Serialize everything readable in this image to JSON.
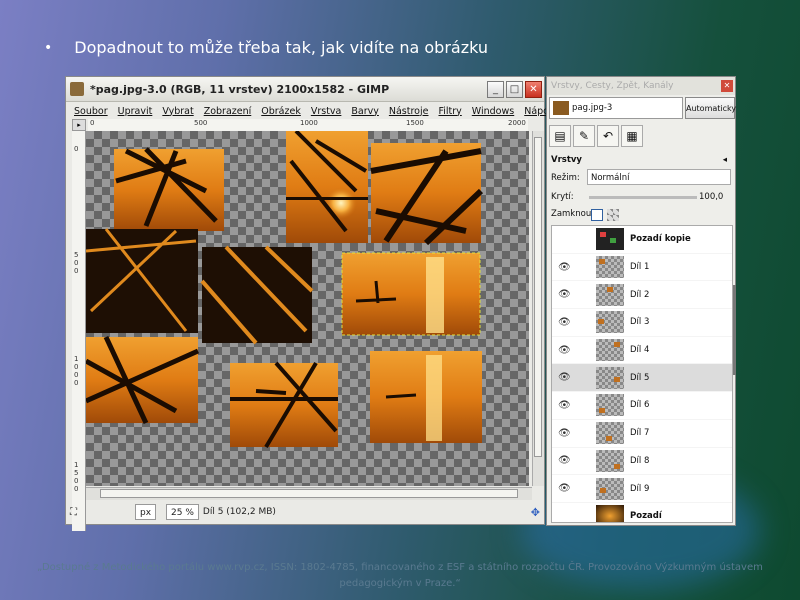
{
  "slide": {
    "bullet": "•",
    "text": "Dopadnout to může třeba tak, jak vidíte na obrázku",
    "footer": "„Dostupné z Metodického portálu www.rvp.cz, ISSN: 1802-4785, financovaného z ESF a státního rozpočtu ČR. Provozováno Výzkumným ústavem pedagogickým v Praze.“"
  },
  "gimp_window": {
    "title": "*pag.jpg-3.0 (RGB, 11 vrstev) 2100x1582 - GIMP",
    "buttons": {
      "minimize": "_",
      "maximize": "□",
      "close": "✕"
    },
    "menu": [
      "Soubor",
      "Upravit",
      "Vybrat",
      "Zobrazení",
      "Obrázek",
      "Vrstva",
      "Barvy",
      "Nástroje",
      "Filtry",
      "Windows",
      "Nápověda"
    ],
    "ruler_h": [
      "0",
      "500",
      "1000",
      "1500",
      "2000"
    ],
    "ruler_v": [
      "0",
      "500",
      "1000",
      "1500"
    ],
    "status": {
      "unit": "px",
      "zoom": "25 %",
      "info": "Díl 5 (102,2 MB)"
    }
  },
  "layers_dock": {
    "title": "Vrstvy, Cesty, Zpět, Kanály",
    "image_name": "pag.jpg-3",
    "auto_button": "Automaticky",
    "panel_title": "Vrstvy",
    "mode_label": "Režim:",
    "mode_value": "Normální",
    "opacity_label": "Krytí:",
    "opacity_value": "100,0",
    "lock_label": "Zamknout:",
    "layers": [
      {
        "name": "Pozadí kopie",
        "visible": false,
        "selected": false
      },
      {
        "name": "Díl 1",
        "visible": true,
        "selected": false
      },
      {
        "name": "Díl 2",
        "visible": true,
        "selected": false
      },
      {
        "name": "Díl 3",
        "visible": true,
        "selected": false
      },
      {
        "name": "Díl 4",
        "visible": true,
        "selected": false
      },
      {
        "name": "Díl 5",
        "visible": true,
        "selected": true
      },
      {
        "name": "Díl 6",
        "visible": true,
        "selected": false
      },
      {
        "name": "Díl 7",
        "visible": true,
        "selected": false
      },
      {
        "name": "Díl 8",
        "visible": true,
        "selected": false
      },
      {
        "name": "Díl 9",
        "visible": true,
        "selected": false
      },
      {
        "name": "Pozadí",
        "visible": false,
        "selected": false
      }
    ]
  },
  "colors": {
    "accent_orange": "#e08a1e",
    "sunset_dark": "#2a1606"
  }
}
